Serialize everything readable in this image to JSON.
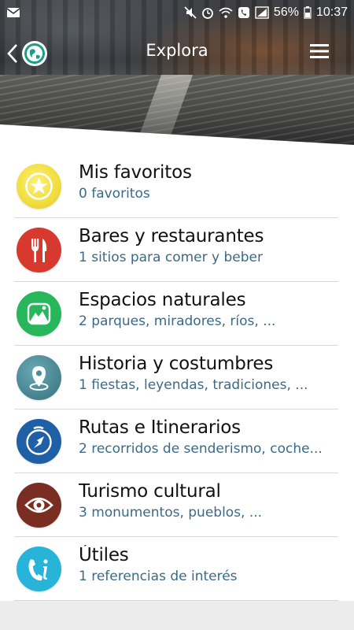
{
  "status_bar": {
    "battery": "56%",
    "time": "10:37",
    "icons": [
      "mail-icon",
      "mute-icon",
      "alarm-icon",
      "wifi-icon",
      "phone-icon",
      "signal-icon",
      "battery-icon"
    ]
  },
  "app_bar": {
    "title": "Explora",
    "back_icon": "chevron-left-icon",
    "logo_icon": "globe-icon",
    "menu_icon": "hamburger-menu-icon"
  },
  "colors": {
    "subtitle": "#3b6a86",
    "favorites": "#f1e04a",
    "bars": "#d8392f",
    "nature": "#27b65a",
    "history": "#4c8a97",
    "routes": "#1f5fa6",
    "culture": "#7a2e22",
    "utils": "#27b4d8"
  },
  "items": [
    {
      "title": "Mis favoritos",
      "subtitle": "0 favoritos",
      "icon": "star-icon"
    },
    {
      "title": "Bares y restaurantes",
      "subtitle": "1 sitios para comer y beber",
      "icon": "fork-knife-icon"
    },
    {
      "title": "Espacios naturales",
      "subtitle": "2 parques, miradores, ríos, ...",
      "icon": "mountain-icon"
    },
    {
      "title": "Historia y costumbres",
      "subtitle": "1 fiestas, leyendas, tradiciones, ...",
      "icon": "map-pin-icon"
    },
    {
      "title": "Rutas e Itinerarios",
      "subtitle": "2 recorridos de senderismo, coche...",
      "icon": "compass-icon"
    },
    {
      "title": "Turismo cultural",
      "subtitle": "3 monumentos, pueblos, ...",
      "icon": "eye-icon"
    },
    {
      "title": "Útiles",
      "subtitle": "1 referencias de interés",
      "icon": "phone-info-icon"
    }
  ]
}
